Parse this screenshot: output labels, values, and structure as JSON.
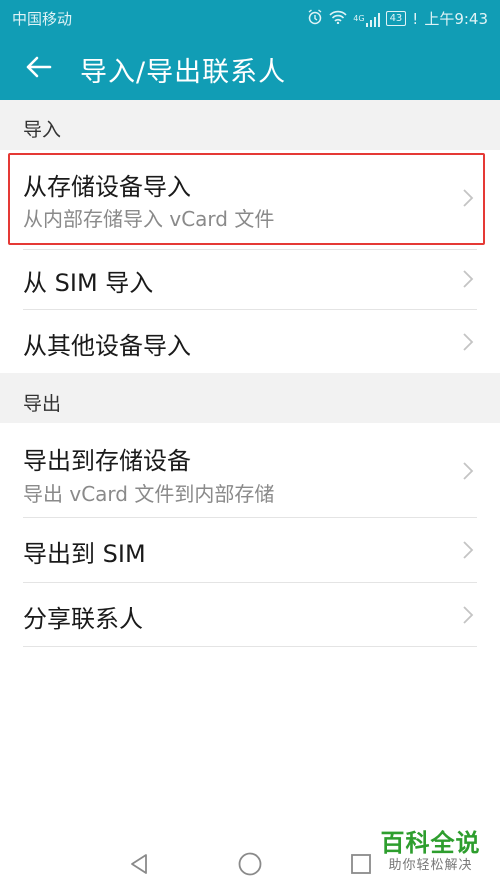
{
  "status_bar": {
    "carrier": "中国移动",
    "network": "4G",
    "battery": "43",
    "alert": "!",
    "time": "上午9:43",
    "icons": [
      "alarm-icon",
      "wifi-icon",
      "signal-icon",
      "battery-icon"
    ]
  },
  "app_bar": {
    "title": "导入/导出联系人",
    "back_icon": "arrow-left-icon"
  },
  "import_section": {
    "header": "导入",
    "items": [
      {
        "title": "从存储设备导入",
        "subtitle": "从内部存储导入 vCard 文件"
      },
      {
        "title": "从 SIM 导入"
      },
      {
        "title": "从其他设备导入"
      }
    ]
  },
  "export_section": {
    "header": "导出",
    "items": [
      {
        "title": "导出到存储设备",
        "subtitle": "导出 vCard 文件到内部存储"
      },
      {
        "title": "导出到 SIM"
      },
      {
        "title": "分享联系人"
      }
    ]
  },
  "nav_bar": {
    "icons": [
      "back-triangle-icon",
      "home-circle-icon",
      "recents-square-icon"
    ]
  },
  "watermark": {
    "title": "百科全说",
    "subtitle": "助你轻松解决"
  },
  "colors": {
    "primary": "#119db5",
    "highlight": "#e53935",
    "section_bg": "#f2f2f2",
    "watermark": "#2e9e2e"
  }
}
